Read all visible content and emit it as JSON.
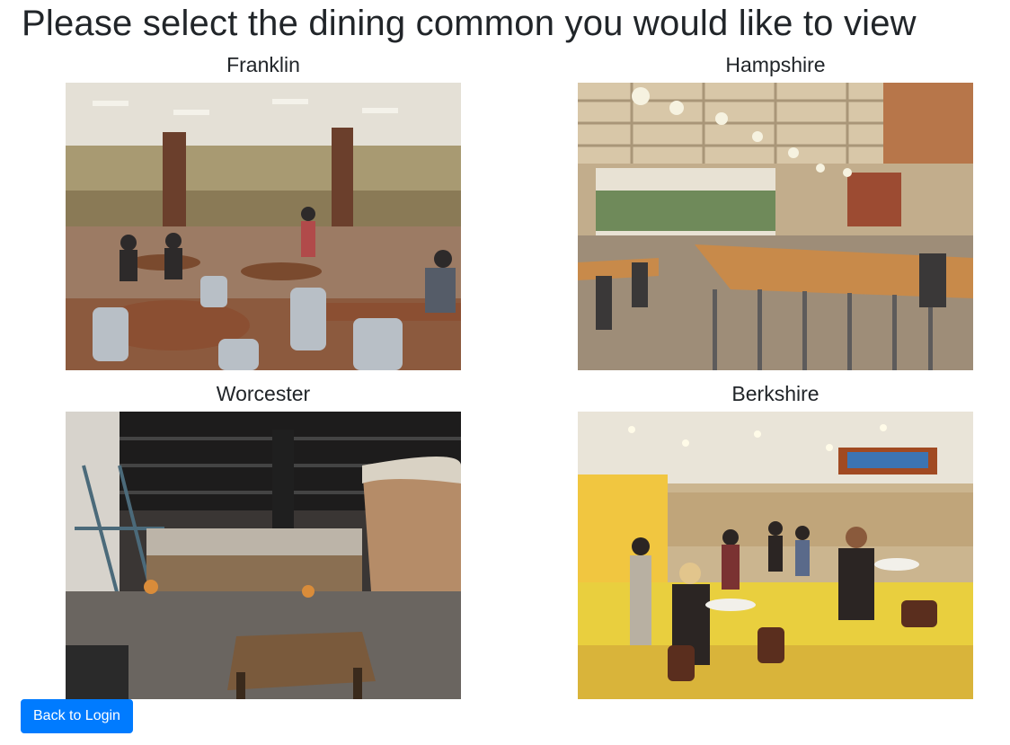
{
  "page": {
    "title": "Please select the dining common you would like to view"
  },
  "dining_commons": [
    {
      "name": "Franklin"
    },
    {
      "name": "Hampshire"
    },
    {
      "name": "Worcester"
    },
    {
      "name": "Berkshire"
    }
  ],
  "actions": {
    "back_label": "Back to Login"
  },
  "colors": {
    "button_primary": "#007bff",
    "text": "#212529"
  }
}
